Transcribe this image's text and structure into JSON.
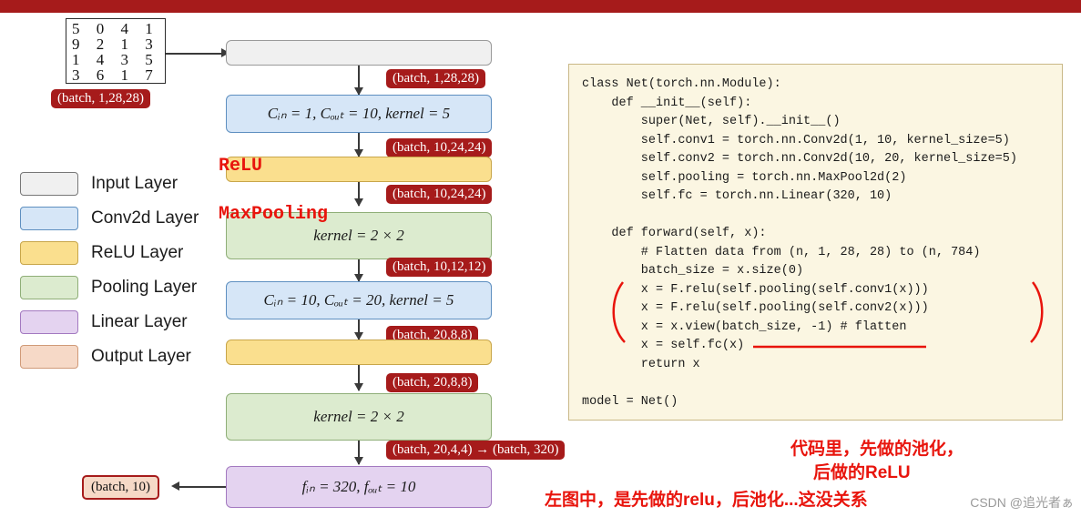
{
  "topbar_color": "#a61b1b",
  "digits_image": {
    "name": "mnist-digits-sample",
    "rows": [
      "5 0 4 1",
      "9 2 1 3",
      "1 4 3 5",
      "3 6 1 7"
    ]
  },
  "legend": {
    "items": [
      {
        "label": "Input Layer",
        "color": "#f0f0f0"
      },
      {
        "label": "Conv2d Layer",
        "color": "#d6e6f7"
      },
      {
        "label": "ReLU Layer",
        "color": "#fadf8e"
      },
      {
        "label": "Pooling Layer",
        "color": "#dcebcf"
      },
      {
        "label": "Linear Layer",
        "color": "#e4d3f0"
      },
      {
        "label": "Output Layer",
        "color": "#f6d9c7"
      }
    ]
  },
  "flow": {
    "nodes": [
      {
        "name": "input-layer-node",
        "text": ""
      },
      {
        "name": "conv1-node",
        "text": "Cᵢₙ = 1, Cₒᵤₜ = 10, kernel = 5"
      },
      {
        "name": "relu1-node",
        "text": ""
      },
      {
        "name": "maxpool1-node",
        "text": "kernel = 2 × 2"
      },
      {
        "name": "conv2-node",
        "text": "Cᵢₙ = 10, Cₒᵤₜ = 20, kernel = 5"
      },
      {
        "name": "relu2-node",
        "text": ""
      },
      {
        "name": "maxpool2-node",
        "text": "kernel = 2 × 2"
      },
      {
        "name": "linear-node",
        "text": "fᵢₙ = 320, fₒᵤₜ = 10"
      }
    ],
    "shape_tags": [
      "(batch, 1,28,28)",
      "(batch, 10,24,24)",
      "(batch, 10,24,24)",
      "(batch, 10,12,12)",
      "(batch, 20,8,8)",
      "(batch, 20,8,8)",
      "(batch, 20,4,4) → (batch, 320)"
    ],
    "input_tag": "(batch, 1,28,28)",
    "output_tag": "(batch, 10)",
    "red_labels": [
      "ReLU",
      "MaxPooling"
    ]
  },
  "code": {
    "lines": [
      "class Net(torch.nn.Module):",
      "    def __init__(self):",
      "        super(Net, self).__init__()",
      "        self.conv1 = torch.nn.Conv2d(1, 10, kernel_size=5)",
      "        self.conv2 = torch.nn.Conv2d(10, 20, kernel_size=5)",
      "        self.pooling = torch.nn.MaxPool2d(2)",
      "        self.fc = torch.nn.Linear(320, 10)",
      "",
      "    def forward(self, x):",
      "        # Flatten data from (n, 1, 28, 28) to (n, 784)",
      "        batch_size = x.size(0)",
      "        x = F.relu(self.pooling(self.conv1(x)))",
      "        x = F.relu(self.pooling(self.conv2(x)))",
      "        x = x.view(batch_size, -1) # flatten",
      "        x = self.fc(x)",
      "        return x",
      "",
      "model = Net()"
    ]
  },
  "annotations": {
    "note_line1": "代码里，先做的池化，",
    "note_line2": "后做的ReLU",
    "note_line3": "左图中，是先做的relu，后池化...这没关系",
    "watermark": "CSDN @追光者ぁ"
  }
}
